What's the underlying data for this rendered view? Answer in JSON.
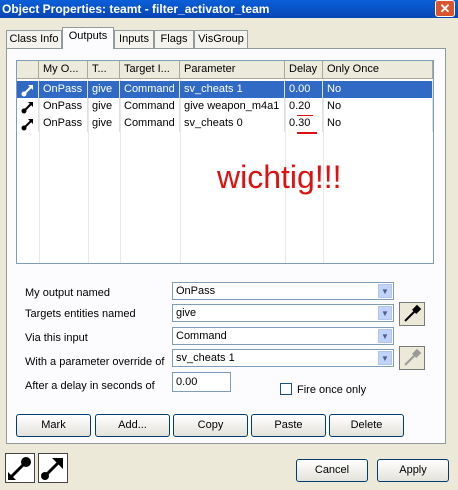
{
  "window": {
    "title": "Object Properties: teamt - filter_activator_team",
    "close_label": "✕"
  },
  "tabs": [
    "Class Info",
    "Outputs",
    "Inputs",
    "Flags",
    "VisGroup"
  ],
  "list": {
    "columns": [
      "My O...",
      "T...",
      "Target I...",
      "Parameter",
      "Delay",
      "Only Once"
    ],
    "rows": [
      {
        "output": "OnPass",
        "target": "give",
        "input": "Command",
        "parameter": "sv_cheats 1",
        "delay": "0.00",
        "once": "No",
        "selected": true
      },
      {
        "output": "OnPass",
        "target": "give",
        "input": "Command",
        "parameter": "give weapon_m4a1",
        "delay": "0.20",
        "once": "No",
        "selected": false
      },
      {
        "output": "OnPass",
        "target": "give",
        "input": "Command",
        "parameter": "sv_cheats 0",
        "delay": "0.30",
        "once": "No",
        "selected": false
      }
    ]
  },
  "annotation": {
    "text": "wichtig!!!",
    "color": "#e01010"
  },
  "form": {
    "output_label": "My output named",
    "output_value": "OnPass",
    "target_label": "Targets entities named",
    "target_value": "give",
    "input_label": "Via this input",
    "input_value": "Command",
    "param_label": "With a parameter override of",
    "param_value": "sv_cheats 1",
    "delay_label": "After a delay in seconds of",
    "delay_value": "0.00",
    "fire_once_label": "Fire once only"
  },
  "buttons": {
    "mark": "Mark",
    "add": "Add...",
    "copy": "Copy",
    "paste": "Paste",
    "delete": "Delete",
    "cancel": "Cancel",
    "apply": "Apply"
  },
  "colors": {
    "title_bar": "#0845b5",
    "selection": "#316ac5",
    "annotation": "#e01010"
  }
}
